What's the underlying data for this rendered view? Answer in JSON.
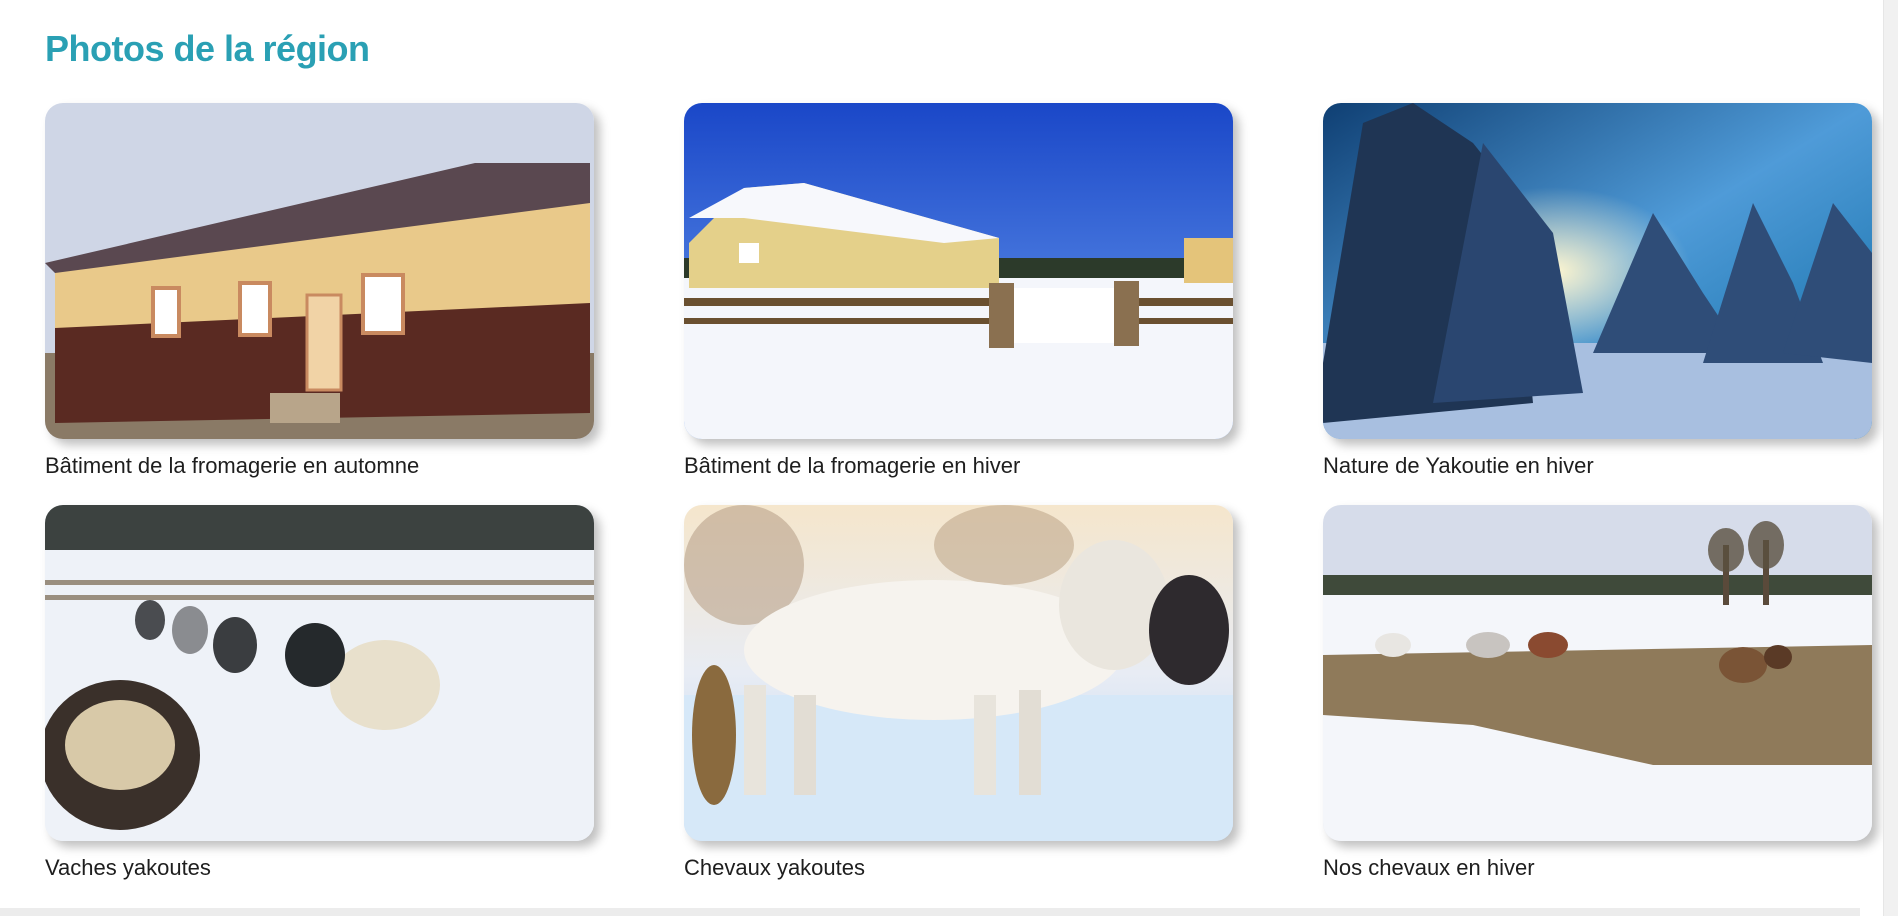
{
  "section": {
    "title": "Photos de la région"
  },
  "photos": [
    {
      "caption": "Bâtiment de la fromagerie en automne",
      "icon": "building-autumn-photo"
    },
    {
      "caption": "Bâtiment de la fromagerie en hiver",
      "icon": "building-winter-photo"
    },
    {
      "caption": "Nature de Yakoutie en hiver",
      "icon": "snowy-forest-photo"
    },
    {
      "caption": "Vaches yakoutes",
      "icon": "cows-photo"
    },
    {
      "caption": "Chevaux yakoutes",
      "icon": "horse-photo"
    },
    {
      "caption": "Nos chevaux en hiver",
      "icon": "horses-field-photo"
    }
  ],
  "colors": {
    "title": "#2aa0b4",
    "caption": "#1e1e1e"
  }
}
